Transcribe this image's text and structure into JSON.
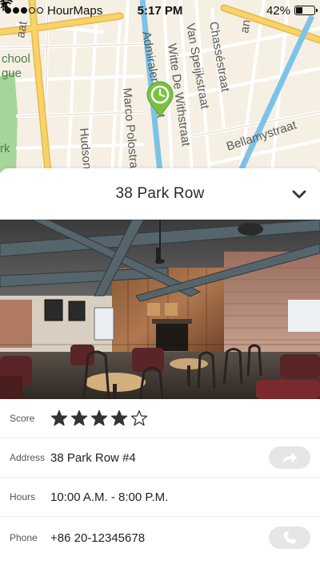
{
  "status_bar": {
    "carrier": "HourMaps",
    "time": "5:17 PM",
    "battery_text": "42%",
    "battery_level": 0.42,
    "signal_bars_filled": 3,
    "signal_bars_total": 5
  },
  "map": {
    "street_labels": [
      "Admiralengracht",
      "Van Speijkstraat",
      "Witte De Withstraat",
      "Chasséstraat",
      "Marco Polostraat",
      "Hudsonstraat",
      "Bellamystraat",
      "aat",
      "an"
    ],
    "park_labels": [
      "chool",
      "gue",
      "rk"
    ],
    "pin_icon": "clock-pin-icon",
    "pin_color": "#7ac142"
  },
  "place": {
    "title": "38 Park Row",
    "collapse_icon": "chevron-down-icon"
  },
  "details": {
    "score_label": "Score",
    "rating": 4,
    "rating_max": 5,
    "address_label": "Address",
    "address_value": "38 Park Row #4",
    "directions_icon": "share-arrow-icon",
    "hours_label": "Hours",
    "hours_value": "10:00 A.M. - 8:00 P.M.",
    "phone_label": "Phone",
    "phone_value": "+86 20-12345678",
    "call_icon": "phone-icon"
  },
  "colors": {
    "accent": "#7ac142",
    "road_yellow": "#f7d36a",
    "canal_blue": "#7cc3e8",
    "park_green": "#a6d59a",
    "button_gray": "#e6e6e6"
  }
}
